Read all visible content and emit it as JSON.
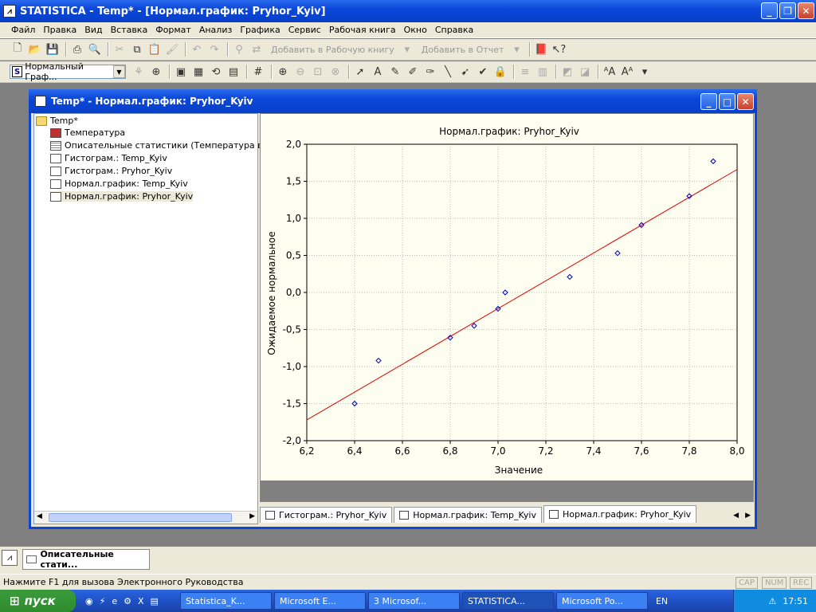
{
  "app": {
    "title": "STATISTICA - Temp* - [Нормал.график: Pryhor_Kyiv]"
  },
  "menu": [
    "Файл",
    "Правка",
    "Вид",
    "Вставка",
    "Формат",
    "Анализ",
    "Графика",
    "Сервис",
    "Рабочая книга",
    "Окно",
    "Справка"
  ],
  "toolbar1": {
    "add_workbook": "Добавить в Рабочую книгу",
    "add_report": "Добавить в Отчет"
  },
  "toolbar2": {
    "graph_combo": "Нормальный Граф..."
  },
  "mdi": {
    "title": "Temp* - Нормал.график: Pryhor_Kyiv"
  },
  "tree": {
    "root": "Temp*",
    "items": [
      "Температура",
      "Описательные статистики (Температура в Тем",
      "Гистограм.: Temp_Kyiv",
      "Гистограм.: Pryhor_Kyiv",
      "Нормал.график: Temp_Kyiv",
      "Нормал.график: Pryhor_Kyiv"
    ]
  },
  "tabs": [
    "Гистограм.: Pryhor_Kyiv",
    "Нормал.график: Temp_Kyiv",
    "Нормал.график: Pryhor_Kyiv"
  ],
  "chart_data": {
    "type": "scatter",
    "title": "Нормал.график: Pryhor_Kyiv",
    "xlabel": "Значение",
    "ylabel": "Ожидаемое нормальное",
    "xlim": [
      6.2,
      8.0
    ],
    "ylim": [
      -2.0,
      2.0
    ],
    "xticks": [
      "6,2",
      "6,4",
      "6,6",
      "6,8",
      "7,0",
      "7,2",
      "7,4",
      "7,6",
      "7,8",
      "8,0"
    ],
    "yticks": [
      "2,0",
      "1,5",
      "1,0",
      "0,5",
      "0,0",
      "-0,5",
      "-1,0",
      "-1,5",
      "-2,0"
    ],
    "grid": true,
    "points": [
      {
        "x": 6.4,
        "y": -1.5
      },
      {
        "x": 6.5,
        "y": -0.92
      },
      {
        "x": 6.8,
        "y": -0.61
      },
      {
        "x": 6.9,
        "y": -0.45
      },
      {
        "x": 7.0,
        "y": -0.22
      },
      {
        "x": 7.03,
        "y": 0.0
      },
      {
        "x": 7.3,
        "y": 0.21
      },
      {
        "x": 7.5,
        "y": 0.53
      },
      {
        "x": 7.6,
        "y": 0.91
      },
      {
        "x": 7.8,
        "y": 1.3
      },
      {
        "x": 7.9,
        "y": 1.77
      }
    ],
    "fit_line": [
      {
        "x": 6.2,
        "y": -1.72
      },
      {
        "x": 8.0,
        "y": 1.66
      }
    ],
    "colors": {
      "points": "#0000c0",
      "line": "#e00000"
    }
  },
  "taskpane": {
    "item": "Описательные стати..."
  },
  "status": {
    "text": "Нажмите F1 для вызова Электронного Руководства",
    "indicators": [
      "CAP",
      "NUM",
      "REC"
    ]
  },
  "taskbar": {
    "start": "пуск",
    "tasks": [
      "Statistica_K...",
      "Microsoft E...",
      "3 Microsof...",
      "STATISTICA...",
      "Microsoft Po..."
    ],
    "lang": "EN",
    "time": "17:51"
  }
}
